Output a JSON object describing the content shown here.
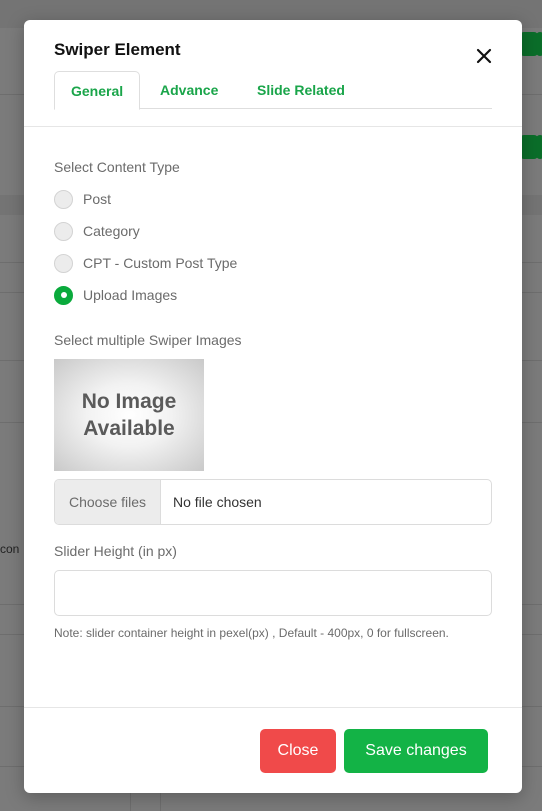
{
  "background": {
    "partial_text": "con"
  },
  "modal": {
    "title": "Swiper Element",
    "tabs": [
      {
        "label": "General",
        "active": true
      },
      {
        "label": "Advance",
        "active": false
      },
      {
        "label": "Slide Related",
        "active": false
      }
    ],
    "content_type": {
      "label": "Select Content Type",
      "options": [
        {
          "label": "Post",
          "checked": false
        },
        {
          "label": "Category",
          "checked": false
        },
        {
          "label": "CPT - Custom Post Type",
          "checked": false
        },
        {
          "label": "Upload Images",
          "checked": true
        }
      ]
    },
    "images": {
      "label": "Select multiple Swiper Images",
      "placeholder_line1": "No Image",
      "placeholder_line2": "Available",
      "file_button": "Choose files",
      "file_status": "No file chosen"
    },
    "slider_height": {
      "label": "Slider Height (in px)",
      "value": "",
      "note": "Note: slider container height in pexel(px) , Default - 400px, 0 for fullscreen."
    },
    "footer": {
      "close_label": "Close",
      "save_label": "Save changes"
    }
  },
  "colors": {
    "accent": "#13b346",
    "danger": "#f04a4a",
    "tab_text": "#1aa54a"
  }
}
